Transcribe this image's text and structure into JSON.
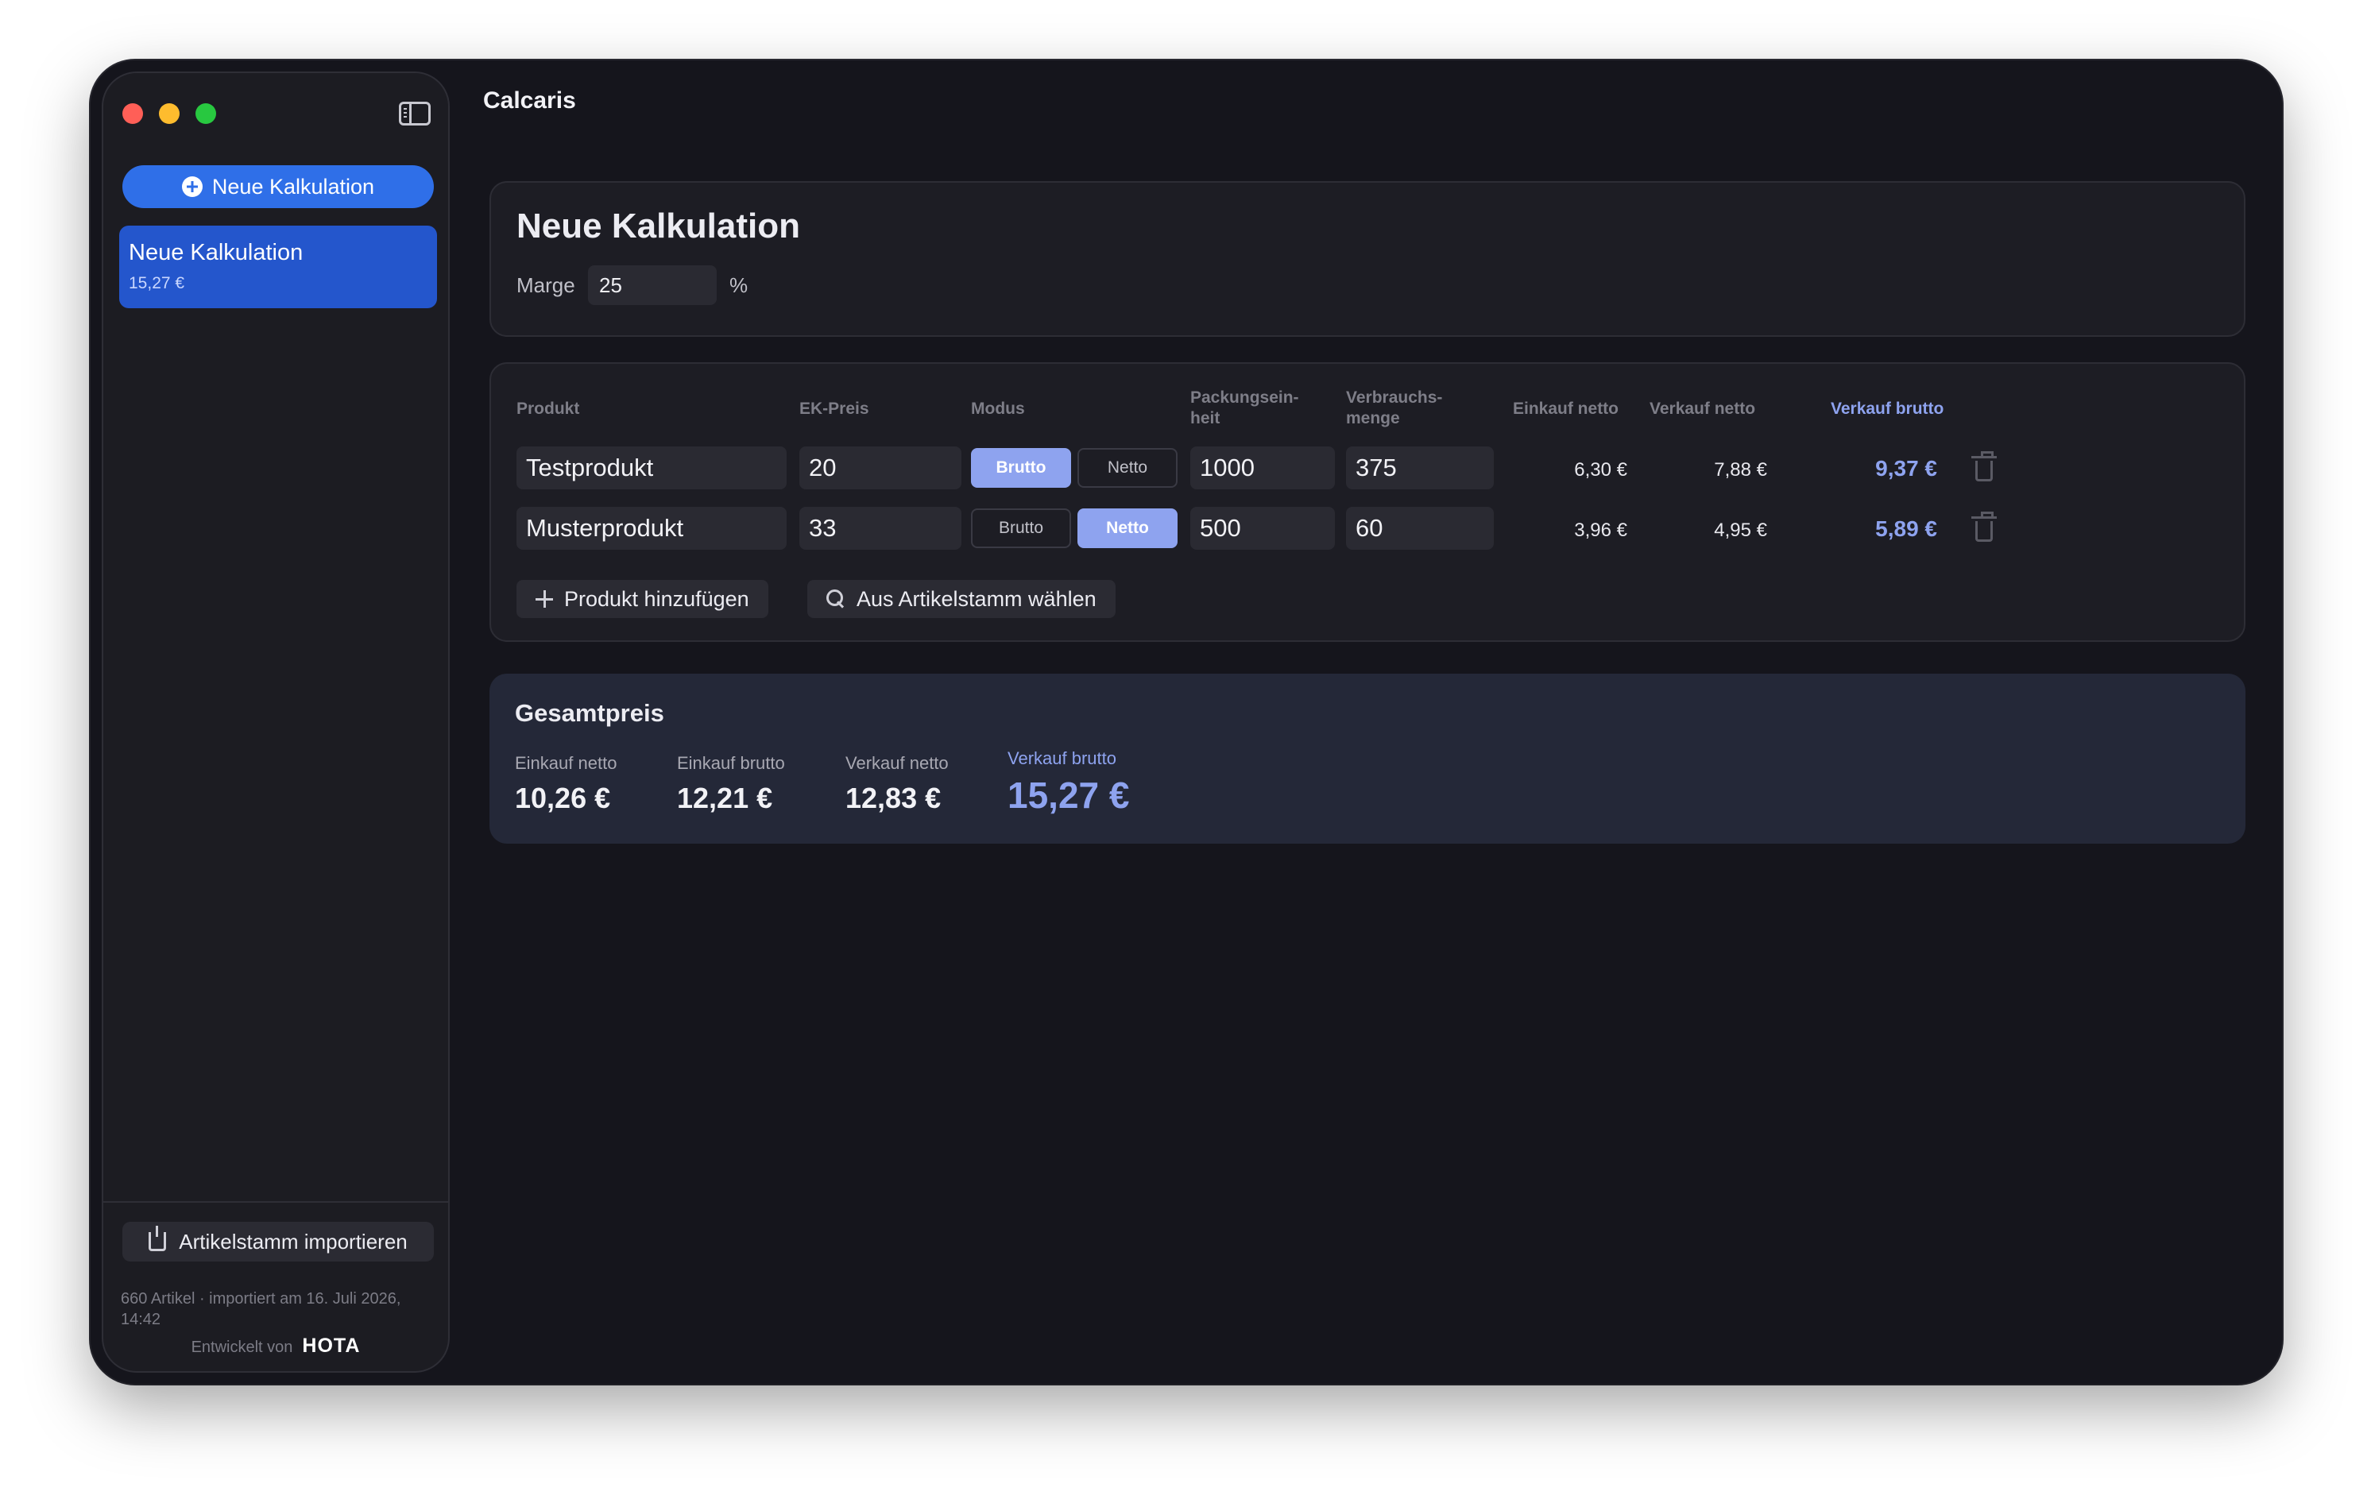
{
  "app": {
    "title": "Calcaris"
  },
  "sidebar": {
    "new_button_label": "Neue Kalkulation",
    "items": [
      {
        "title": "Neue Kalkulation",
        "subtitle": "15,27 €"
      }
    ],
    "import_button_label": "Artikelstamm importieren",
    "import_info": "660 Artikel · importiert am 16. Juli 2026, 14:42",
    "developer_prefix": "Entwickelt von",
    "developer_brand": "HOTA"
  },
  "calculation": {
    "title": "Neue Kalkulation",
    "marge_label": "Marge",
    "marge_value": "25",
    "marge_unit": "%"
  },
  "table": {
    "headers": {
      "produkt": "Produkt",
      "ek_preis": "EK-Preis",
      "modus": "Modus",
      "packungseinheit": "Packungsein-\nheit",
      "verbrauchsmenge": "Verbrauchs-\nmenge",
      "einkauf_netto": "Einkauf netto",
      "verkauf_netto": "Verkauf netto",
      "verkauf_brutto": "Verkauf brutto"
    },
    "mode_options": {
      "brutto": "Brutto",
      "netto": "Netto"
    },
    "rows": [
      {
        "produkt": "Testprodukt",
        "ek_preis": "20",
        "modus": "Brutto",
        "packungseinheit": "1000",
        "verbrauchsmenge": "375",
        "einkauf_netto": "6,30 €",
        "verkauf_netto": "7,88 €",
        "verkauf_brutto": "9,37 €"
      },
      {
        "produkt": "Musterprodukt",
        "ek_preis": "33",
        "modus": "Netto",
        "packungseinheit": "500",
        "verbrauchsmenge": "60",
        "einkauf_netto": "3,96 €",
        "verkauf_netto": "4,95 €",
        "verkauf_brutto": "5,89 €"
      }
    ],
    "add_product_label": "Produkt hinzufügen",
    "choose_from_catalog_label": "Aus Artikelstamm wählen"
  },
  "totals": {
    "title": "Gesamtpreis",
    "items": [
      {
        "label": "Einkauf netto",
        "value": "10,26 €"
      },
      {
        "label": "Einkauf brutto",
        "value": "12,21 €"
      },
      {
        "label": "Verkauf netto",
        "value": "12,83 €"
      },
      {
        "label": "Verkauf brutto",
        "value": "15,27 €"
      }
    ]
  },
  "colors": {
    "accent": "#8ea3ef",
    "primary_button": "#2f6fe8",
    "selected_item": "#2456cc",
    "window_bg": "#15151c"
  },
  "icons": [
    "plus-circle-icon",
    "sidebar-toggle-icon",
    "import-icon",
    "plus-icon",
    "search-icon",
    "trash-icon"
  ]
}
